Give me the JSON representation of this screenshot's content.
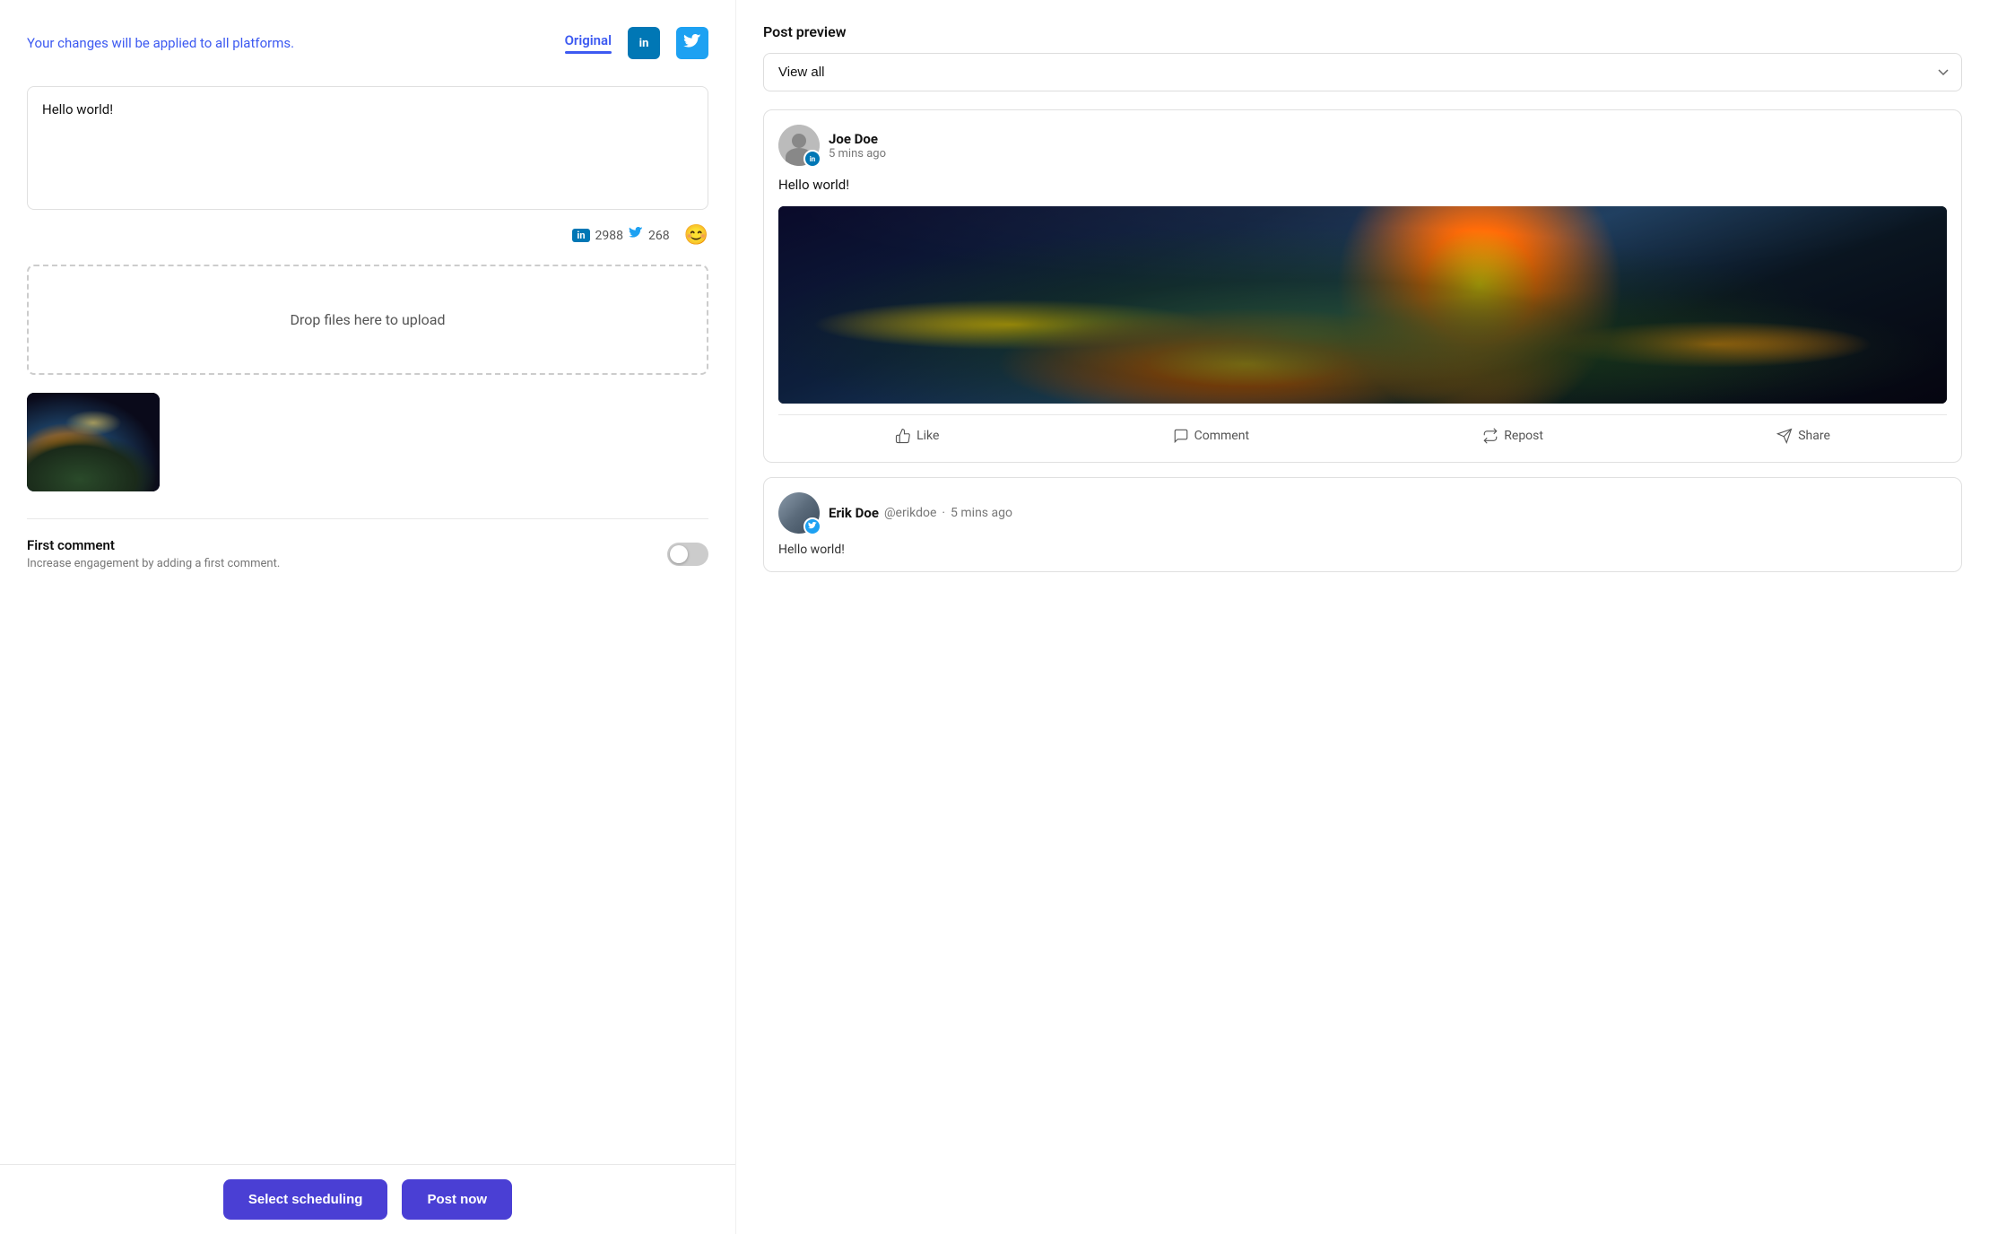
{
  "left": {
    "changes_note": "Your changes will be applied to all platforms.",
    "tabs": [
      {
        "label": "Original",
        "active": true
      },
      {
        "label": "LinkedIn",
        "icon": "linkedin"
      },
      {
        "label": "Twitter",
        "icon": "twitter"
      }
    ],
    "editor": {
      "content": "Hello world!",
      "placeholder": "Write your post..."
    },
    "char_counts": {
      "linkedin": "2988",
      "twitter": "268"
    },
    "drop_zone": "Drop files here to upload",
    "first_comment": {
      "title": "First comment",
      "description": "Increase engagement by adding a first comment.",
      "enabled": false
    },
    "actions": {
      "scheduling": "Select scheduling",
      "post_now": "Post now"
    }
  },
  "right": {
    "title": "Post preview",
    "view_all_label": "View all",
    "linkedin_post": {
      "author": "Joe Doe",
      "time": "5 mins ago",
      "text": "Hello world!",
      "actions": [
        "Like",
        "Comment",
        "Repost",
        "Share"
      ]
    },
    "twitter_post": {
      "author": "Erik Doe",
      "handle": "@erikdoe",
      "time": "5 mins ago",
      "text": "Hello world!"
    }
  },
  "colors": {
    "accent": "#4a3fd4",
    "linkedin": "#0077b5",
    "twitter": "#1da1f2"
  }
}
